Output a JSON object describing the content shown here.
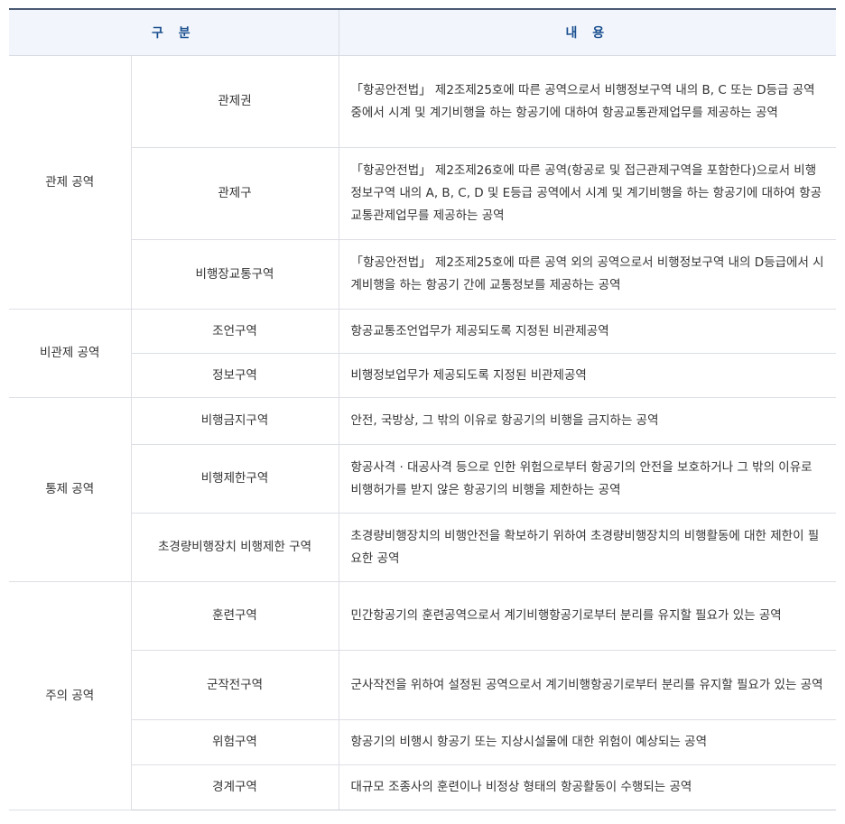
{
  "header": {
    "col1": "구 분",
    "col2": "내 용"
  },
  "groups": [
    {
      "category": "관제 공역",
      "rows": [
        {
          "sub": "관제권",
          "desc": "「항공안전법」 제2조제25호에 따른 공역으로서 비행정보구역 내의 B, C 또는 D등급 공역 중에서 시계 및 계기비행을 하는 항공기에 대하여 항공교통관제업무를 제공하는 공역"
        },
        {
          "sub": "관제구",
          "desc": "「항공안전법」 제2조제26호에 따른 공역(항공로 및 접근관제구역을 포함한다)으로서 비행정보구역 내의 A, B, C, D 및 E등급 공역에서 시계 및 계기비행을 하는 항공기에 대하여 항공교통관제업무를 제공하는 공역"
        },
        {
          "sub": "비행장교통구역",
          "desc": "「항공안전법」 제2조제25호에 따른 공역 외의 공역으로서 비행정보구역 내의 D등급에서 시계비행을 하는 항공기 간에 교통정보를 제공하는 공역"
        }
      ]
    },
    {
      "category": "비관제 공역",
      "rows": [
        {
          "sub": "조언구역",
          "desc": "항공교통조언업무가 제공되도록 지정된 비관제공역"
        },
        {
          "sub": "정보구역",
          "desc": "비행정보업무가 제공되도록 지정된 비관제공역"
        }
      ]
    },
    {
      "category": "통제 공역",
      "rows": [
        {
          "sub": "비행금지구역",
          "desc": "안전, 국방상, 그 밖의 이유로 항공기의 비행을 금지하는 공역"
        },
        {
          "sub": "비행제한구역",
          "desc": "항공사격 · 대공사격 등으로 인한 위험으로부터 항공기의 안전을 보호하거나 그 밖의 이유로 비행허가를 받지 않은 항공기의 비행을 제한하는 공역"
        },
        {
          "sub": "초경량비행장치 비행제한 구역",
          "desc": "초경량비행장치의 비행안전을 확보하기 위하여 초경량비행장치의 비행활동에 대한 제한이 필요한 공역"
        }
      ]
    },
    {
      "category": "주의 공역",
      "rows": [
        {
          "sub": "훈련구역",
          "desc": "민간항공기의 훈련공역으로서 계기비행항공기로부터 분리를 유지할 필요가 있는 공역"
        },
        {
          "sub": "군작전구역",
          "desc": "군사작전을 위하여 설정된 공역으로서 계기비행항공기로부터  분리를 유지할 필요가 있는 공역"
        },
        {
          "sub": "위험구역",
          "desc": "항공기의 비행시 항공기 또는 지상시설물에 대한 위험이 예상되는 공역"
        },
        {
          "sub": "경계구역",
          "desc": "대규모 조종사의 훈련이나 비정상 형태의 항공활동이 수행되는 공역"
        }
      ]
    }
  ]
}
